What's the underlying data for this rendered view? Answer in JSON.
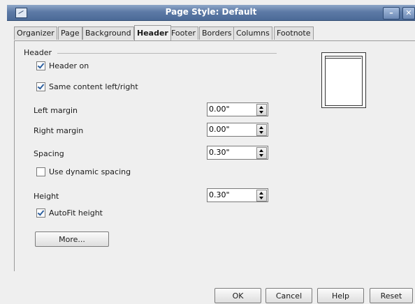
{
  "window": {
    "title": "Page Style: Default",
    "minimize_icon": "minimize-icon",
    "close_icon": "close-icon"
  },
  "tabs": [
    "Organizer",
    "Page",
    "Background",
    "Header",
    "Footer",
    "Borders",
    "Columns",
    "Footnote"
  ],
  "active_tab": "Header",
  "header_group": {
    "label": "Header",
    "header_on": {
      "label": "Header on",
      "checked": true
    },
    "same_content": {
      "label": "Same content left/right",
      "checked": true
    },
    "left_margin": {
      "label": "Left margin",
      "value": "0.00\""
    },
    "right_margin": {
      "label": "Right margin",
      "value": "0.00\""
    },
    "spacing": {
      "label": "Spacing",
      "value": "0.30\""
    },
    "dynamic_spacing": {
      "label": "Use dynamic spacing",
      "checked": false
    },
    "height": {
      "label": "Height",
      "value": "0.30\""
    },
    "autofit": {
      "label": "AutoFit height",
      "checked": true
    },
    "more_button": "More..."
  },
  "buttons": {
    "ok": "OK",
    "cancel": "Cancel",
    "help": "Help",
    "reset": "Reset"
  }
}
